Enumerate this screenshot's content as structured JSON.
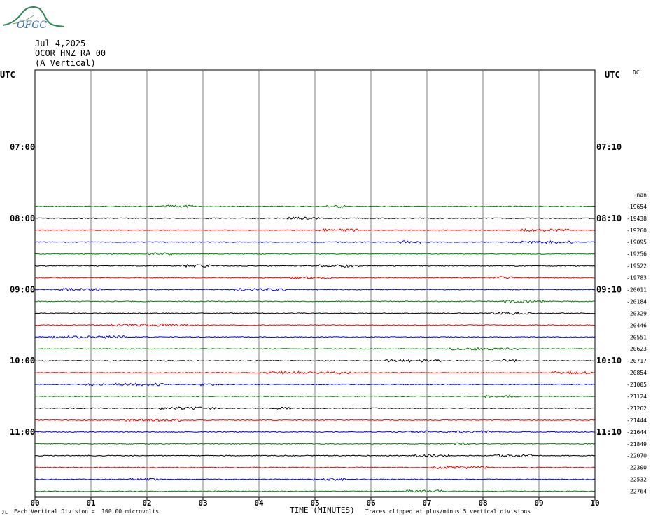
{
  "header": {
    "logo_text": "OFGC",
    "date": "Jul 4,2025",
    "station": "OCOR HNZ RA 00",
    "component": "(A Vertical)",
    "utc_left": "UTC",
    "utc_right": "UTC",
    "dc_label": "DC"
  },
  "footer": {
    "xlabel": "TIME (MINUTES)",
    "division_note": "Each Vertical Division =  100.00 microvolts",
    "clip_note": "Traces clipped at plus/minus 5 vertical divisions",
    "corner_mark": "ᴊʟ"
  },
  "chart_data": {
    "type": "line",
    "title": "",
    "xlabel": "TIME (MINUTES)",
    "x_ticks": [
      "00",
      "01",
      "02",
      "03",
      "04",
      "05",
      "06",
      "07",
      "08",
      "09",
      "10"
    ],
    "xlim": [
      0,
      10
    ],
    "left_time_labels": [
      {
        "text": "07:00",
        "row": 6
      },
      {
        "text": "08:00",
        "row": 12
      },
      {
        "text": "09:00",
        "row": 18
      },
      {
        "text": "10:00",
        "row": 24
      },
      {
        "text": "11:00",
        "row": 30
      }
    ],
    "right_time_labels": [
      {
        "text": "07:10",
        "row": 6
      },
      {
        "text": "08:10",
        "row": 12
      },
      {
        "text": "09:10",
        "row": 18
      },
      {
        "text": "10:10",
        "row": 24
      },
      {
        "text": "11:10",
        "row": 30
      }
    ],
    "dc_offsets": [
      {
        "text": "-nan",
        "row": 10
      },
      {
        "text": "-19654",
        "row": 11
      },
      {
        "text": "-19438",
        "row": 12
      },
      {
        "text": "-19260",
        "row": 13
      },
      {
        "text": "-19095",
        "row": 14
      },
      {
        "text": "-19256",
        "row": 15
      },
      {
        "text": "-19522",
        "row": 16
      },
      {
        "text": "-19783",
        "row": 17
      },
      {
        "text": "-20011",
        "row": 18
      },
      {
        "text": "-20184",
        "row": 19
      },
      {
        "text": "-20329",
        "row": 20
      },
      {
        "text": "-20446",
        "row": 21
      },
      {
        "text": "-20551",
        "row": 22
      },
      {
        "text": "-20623",
        "row": 23
      },
      {
        "text": "-20717",
        "row": 24
      },
      {
        "text": "-20854",
        "row": 25
      },
      {
        "text": "-21005",
        "row": 26
      },
      {
        "text": "-21124",
        "row": 27
      },
      {
        "text": "-21262",
        "row": 28
      },
      {
        "text": "-21444",
        "row": 29
      },
      {
        "text": "-21644",
        "row": 30
      },
      {
        "text": "-21849",
        "row": 31
      },
      {
        "text": "-22070",
        "row": 32
      },
      {
        "text": "-22300",
        "row": 33
      },
      {
        "text": "-22532",
        "row": 34
      },
      {
        "text": "-22764",
        "row": 35
      }
    ],
    "trace_colors": [
      "#008000",
      "#000000",
      "#ff0000",
      "#0000ff"
    ],
    "first_trace_row": 11,
    "last_trace_row": 35,
    "rows_total": 36,
    "grid": true
  }
}
